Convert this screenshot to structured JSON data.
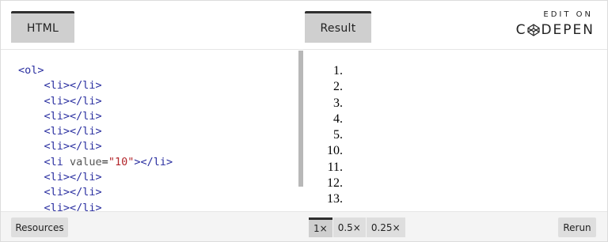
{
  "tabs": {
    "html_label": "HTML",
    "result_label": "Result"
  },
  "codepen": {
    "edit_on": "EDIT ON",
    "brand_left": "C",
    "brand_right": "DEPEN"
  },
  "code": {
    "lines": [
      {
        "indent": "",
        "open": "<ol>",
        "attr": "",
        "eq": "",
        "value": "",
        "close": ""
      },
      {
        "indent": "    ",
        "open": "<li></li>",
        "attr": "",
        "eq": "",
        "value": "",
        "close": ""
      },
      {
        "indent": "    ",
        "open": "<li></li>",
        "attr": "",
        "eq": "",
        "value": "",
        "close": ""
      },
      {
        "indent": "    ",
        "open": "<li></li>",
        "attr": "",
        "eq": "",
        "value": "",
        "close": ""
      },
      {
        "indent": "    ",
        "open": "<li></li>",
        "attr": "",
        "eq": "",
        "value": "",
        "close": ""
      },
      {
        "indent": "    ",
        "open": "<li></li>",
        "attr": "",
        "eq": "",
        "value": "",
        "close": ""
      },
      {
        "indent": "    ",
        "open": "<li ",
        "attr": "value",
        "eq": "=",
        "value": "\"10\"",
        "close": "></li>"
      },
      {
        "indent": "    ",
        "open": "<li></li>",
        "attr": "",
        "eq": "",
        "value": "",
        "close": ""
      },
      {
        "indent": "    ",
        "open": "<li></li>",
        "attr": "",
        "eq": "",
        "value": "",
        "close": ""
      },
      {
        "indent": "    ",
        "open": "<li></li>",
        "attr": "",
        "eq": "",
        "value": "",
        "close": ""
      }
    ]
  },
  "result": {
    "items": [
      "1.",
      "2.",
      "3.",
      "4.",
      "5.",
      "10.",
      "11.",
      "12.",
      "13."
    ]
  },
  "footer": {
    "resources_label": "Resources",
    "zoom_options": [
      "1×",
      "0.5×",
      "0.25×"
    ],
    "active_zoom": "1×",
    "rerun_label": "Rerun"
  },
  "colors": {
    "tag": "#2a2fa0",
    "attr": "#555555",
    "string": "#b3262b",
    "tab_bg": "#cfcfcf",
    "tab_top": "#2f2f2f"
  },
  "icons": {
    "codepen_logo": "codepen-logo-icon"
  }
}
